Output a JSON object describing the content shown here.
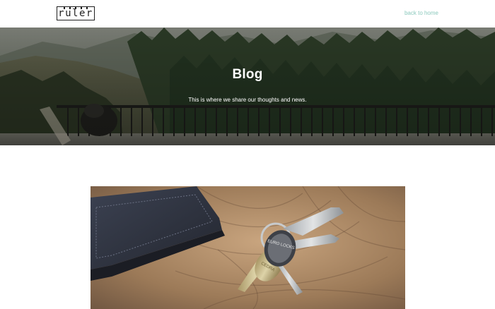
{
  "header": {
    "logo_text": "ruler",
    "back_link": "back to home"
  },
  "hero": {
    "title": "Blog",
    "subtitle": "This is where we share our thoughts and news."
  },
  "post": {
    "key_tag_text": "EURO LOCKS",
    "key_brand_text": "CEDRA"
  },
  "colors": {
    "link": "#8cc9bd",
    "logo": "#1f1f1f",
    "hero_text": "#ffffff"
  }
}
